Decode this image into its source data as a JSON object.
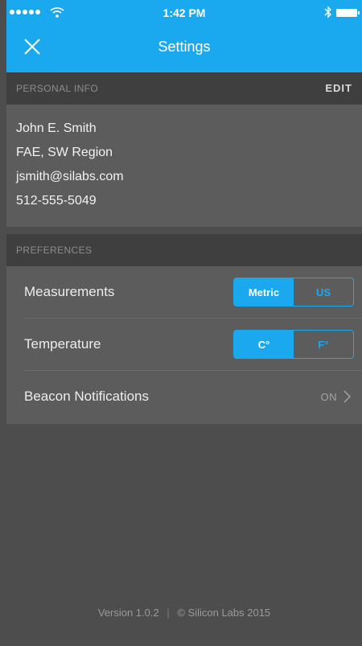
{
  "status": {
    "time": "1:42 PM"
  },
  "header": {
    "title": "Settings"
  },
  "personal": {
    "section_label": "PERSONAL INFO",
    "edit_label": "EDIT",
    "name": "John E. Smith",
    "role": "FAE, SW Region",
    "email": "jsmith@silabs.com",
    "phone": "512-555-5049"
  },
  "preferences": {
    "section_label": "PREFERENCES",
    "measurements": {
      "label": "Measurements",
      "options": [
        "Metric",
        "US"
      ],
      "selected": "Metric"
    },
    "temperature": {
      "label": "Temperature",
      "options": [
        "C°",
        "F°"
      ],
      "selected": "C°"
    },
    "beacon": {
      "label": "Beacon Notifications",
      "value": "ON"
    }
  },
  "footer": {
    "version": "Version 1.0.2",
    "separator": "|",
    "copyright": "© Silicon Labs 2015"
  },
  "colors": {
    "accent": "#1aa9ef",
    "background": "#4d4d4d",
    "row_bg": "#5c5c5c",
    "section_bg": "#3f3f3f"
  }
}
